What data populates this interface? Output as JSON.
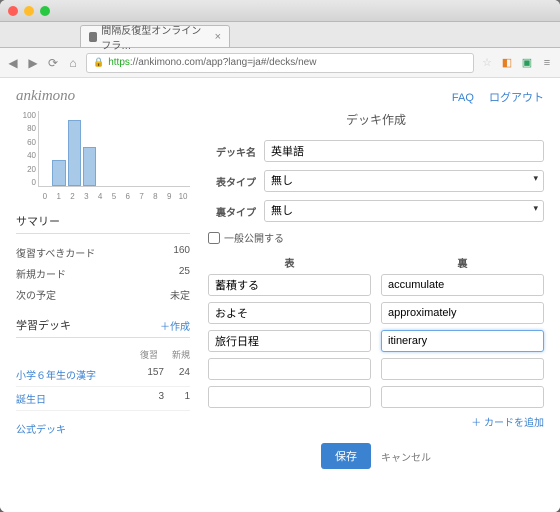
{
  "browser": {
    "tab_title": "間隔反復型オンラインフラ…",
    "url_https": "https",
    "url_rest": "://ankimono.com/app?lang=ja#/decks/new"
  },
  "header": {
    "brand": "ankimono",
    "faq": "FAQ",
    "logout": "ログアウト"
  },
  "chart_data": {
    "type": "bar",
    "categories": [
      "0",
      "1",
      "2",
      "3",
      "4",
      "5",
      "6",
      "7",
      "8",
      "9",
      "10"
    ],
    "values": [
      0,
      35,
      88,
      52,
      0,
      0,
      0,
      0,
      0,
      0,
      0
    ],
    "ylim": [
      0,
      100
    ],
    "yticks": [
      0,
      20,
      40,
      60,
      80,
      100
    ]
  },
  "summary": {
    "title": "サマリー",
    "rows": [
      {
        "label": "復習すべきカード",
        "value": "160"
      },
      {
        "label": "新規カード",
        "value": "25"
      },
      {
        "label": "次の予定",
        "value": "未定"
      }
    ]
  },
  "decks": {
    "title": "学習デッキ",
    "create": "作成",
    "cols": {
      "review": "復習",
      "new": "新規"
    },
    "rows": [
      {
        "name": "小学６年生の漢字",
        "review": "157",
        "new_": "24"
      },
      {
        "name": "誕生日",
        "review": "3",
        "new_": "1"
      }
    ],
    "official": "公式デッキ"
  },
  "form": {
    "page_title": "デッキ作成",
    "deck_name_label": "デッキ名",
    "deck_name_value": "英単語",
    "front_type_label": "表タイプ",
    "back_type_label": "裏タイプ",
    "type_value": "無し",
    "public_label": "一般公開する",
    "front_col": "表",
    "back_col": "裏",
    "cards": [
      {
        "front": "蓄積する",
        "back": "accumulate"
      },
      {
        "front": "およそ",
        "back": "approximately"
      },
      {
        "front": "旅行日程",
        "back": "itinerary"
      },
      {
        "front": "",
        "back": ""
      },
      {
        "front": "",
        "back": ""
      }
    ],
    "add_card": "カードを追加",
    "save": "保存",
    "cancel": "キャンセル"
  }
}
